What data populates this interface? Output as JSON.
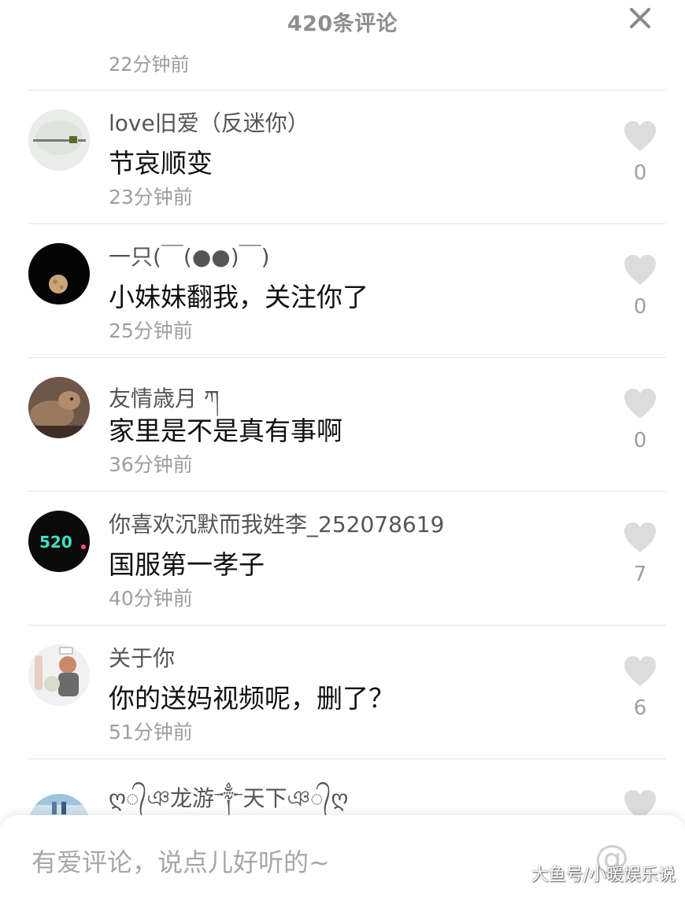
{
  "header": {
    "title": "420条评论",
    "close_icon": "close-icon"
  },
  "top_time": "22分钟前",
  "comments": [
    {
      "username": "love旧爱（反迷你）",
      "text": "节哀顺变",
      "time": "23分钟前",
      "likes": "0",
      "avatar": "text-banner-avatar"
    },
    {
      "username": "一只(￣(●●)￣)",
      "text": "小妹妹翻我，关注你了",
      "time": "25分钟前",
      "likes": "0",
      "avatar": "moon-avatar"
    },
    {
      "username": "友情歳月 ཀ",
      "text": "家里是不是真有事啊",
      "time": "36分钟前",
      "likes": "0",
      "avatar": "dog-avatar"
    },
    {
      "username": "你喜欢沉默而我姓李_252078619",
      "text": "国服第一孝子",
      "time": "40分钟前",
      "likes": "7",
      "avatar": "neon-520-avatar"
    },
    {
      "username": "关于你",
      "text": "你的送妈视频呢，删了？",
      "time": "51分钟前",
      "likes": "6",
      "avatar": "anime-couple-avatar"
    },
    {
      "username": "ღ᭄ঞ龙游༒天下ঞ᭄ღ",
      "avatar": "beach-avatar"
    }
  ],
  "input": {
    "placeholder": "有爱评论，说点儿好听的~",
    "at_symbol": "@"
  },
  "watermark": "大鱼号/小暖娱乐说",
  "colors": {
    "heart": "#dcdcdc",
    "secondary_text": "#9e9e9e"
  }
}
